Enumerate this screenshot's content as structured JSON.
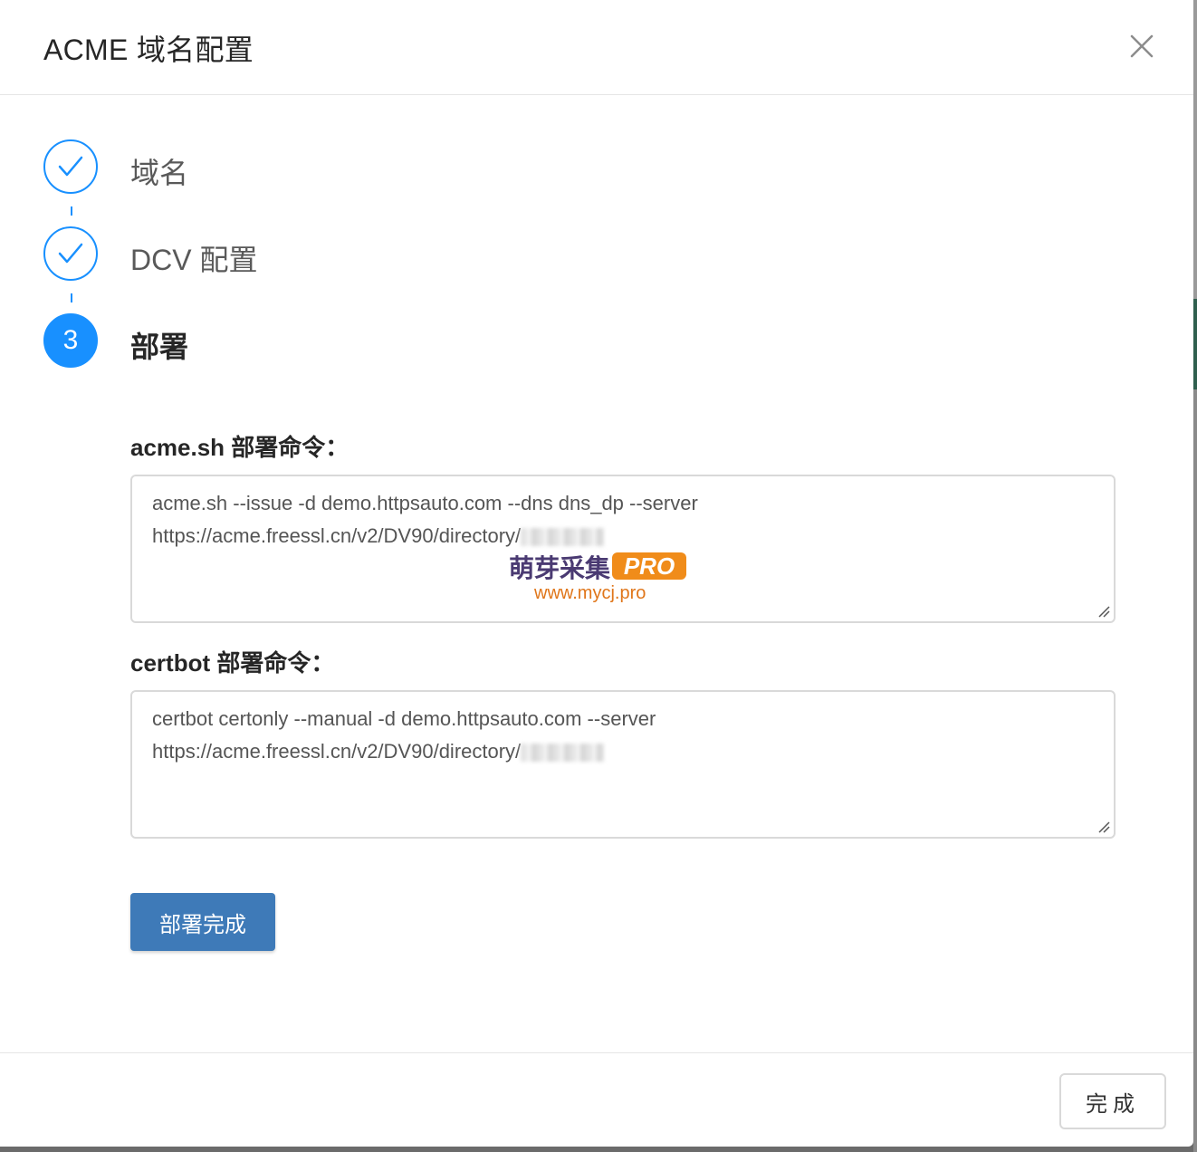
{
  "dialog": {
    "title": "ACME 域名配置",
    "close_icon": "close-icon"
  },
  "steps": [
    {
      "label": "域名",
      "status": "done",
      "icon": "check-icon"
    },
    {
      "label": "DCV 配置",
      "status": "done",
      "icon": "check-icon"
    },
    {
      "label": "部署",
      "status": "active",
      "number": "3"
    }
  ],
  "deploy": {
    "acme_label": "acme.sh 部署命令：",
    "acme_line1": "acme.sh --issue -d demo.httpsauto.com --dns dns_dp --server",
    "acme_line2": "https://acme.freessl.cn/v2/DV90/directory/",
    "certbot_label": "certbot 部署命令：",
    "certbot_line1": "certbot certonly --manual -d demo.httpsauto.com --server",
    "certbot_line2": "https://acme.freessl.cn/v2/DV90/directory/",
    "deploy_done_button": "部署完成"
  },
  "watermark": {
    "text": "萌芽采集",
    "badge": "PRO",
    "url": "www.mycj.pro"
  },
  "footer": {
    "done_button": "完成"
  },
  "colors": {
    "accent": "#1890ff",
    "primary_button": "#3e7ab8",
    "border": "#d9d9d9"
  }
}
